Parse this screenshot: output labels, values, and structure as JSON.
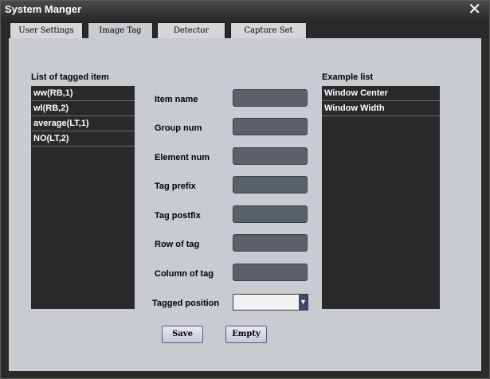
{
  "window": {
    "title": "System Manger"
  },
  "tabs": [
    {
      "label": "User Settings",
      "active": false
    },
    {
      "label": "Image Tag",
      "active": true
    },
    {
      "label": "Detector",
      "active": false
    },
    {
      "label": "Capture Set",
      "active": false
    }
  ],
  "tagged_list": {
    "label": "List of tagged item",
    "items": [
      "ww(RB,1)",
      "wl(RB,2)",
      "average(LT,1)",
      "NO(LT,2)"
    ]
  },
  "form": {
    "item_name": {
      "label": "Item name",
      "value": ""
    },
    "group_num": {
      "label": "Group num",
      "value": ""
    },
    "element_num": {
      "label": "Element num",
      "value": ""
    },
    "tag_prefix": {
      "label": "Tag prefix",
      "value": ""
    },
    "tag_postfix": {
      "label": "Tag postfix",
      "value": ""
    },
    "row_of_tag": {
      "label": "Row of tag",
      "value": ""
    },
    "column_of_tag": {
      "label": "Column of tag",
      "value": ""
    },
    "tagged_position": {
      "label": "Tagged position",
      "value": ""
    }
  },
  "example_list": {
    "label": "Example list",
    "items": [
      "Window Center",
      "Window Width"
    ]
  },
  "buttons": {
    "save": "Save",
    "empty": "Empty"
  },
  "colors": {
    "window_bg": "#2a2a2a",
    "content_bg": "#c8cbd0",
    "field_bg": "#5b6169",
    "list_bg": "#2a2a2a"
  }
}
